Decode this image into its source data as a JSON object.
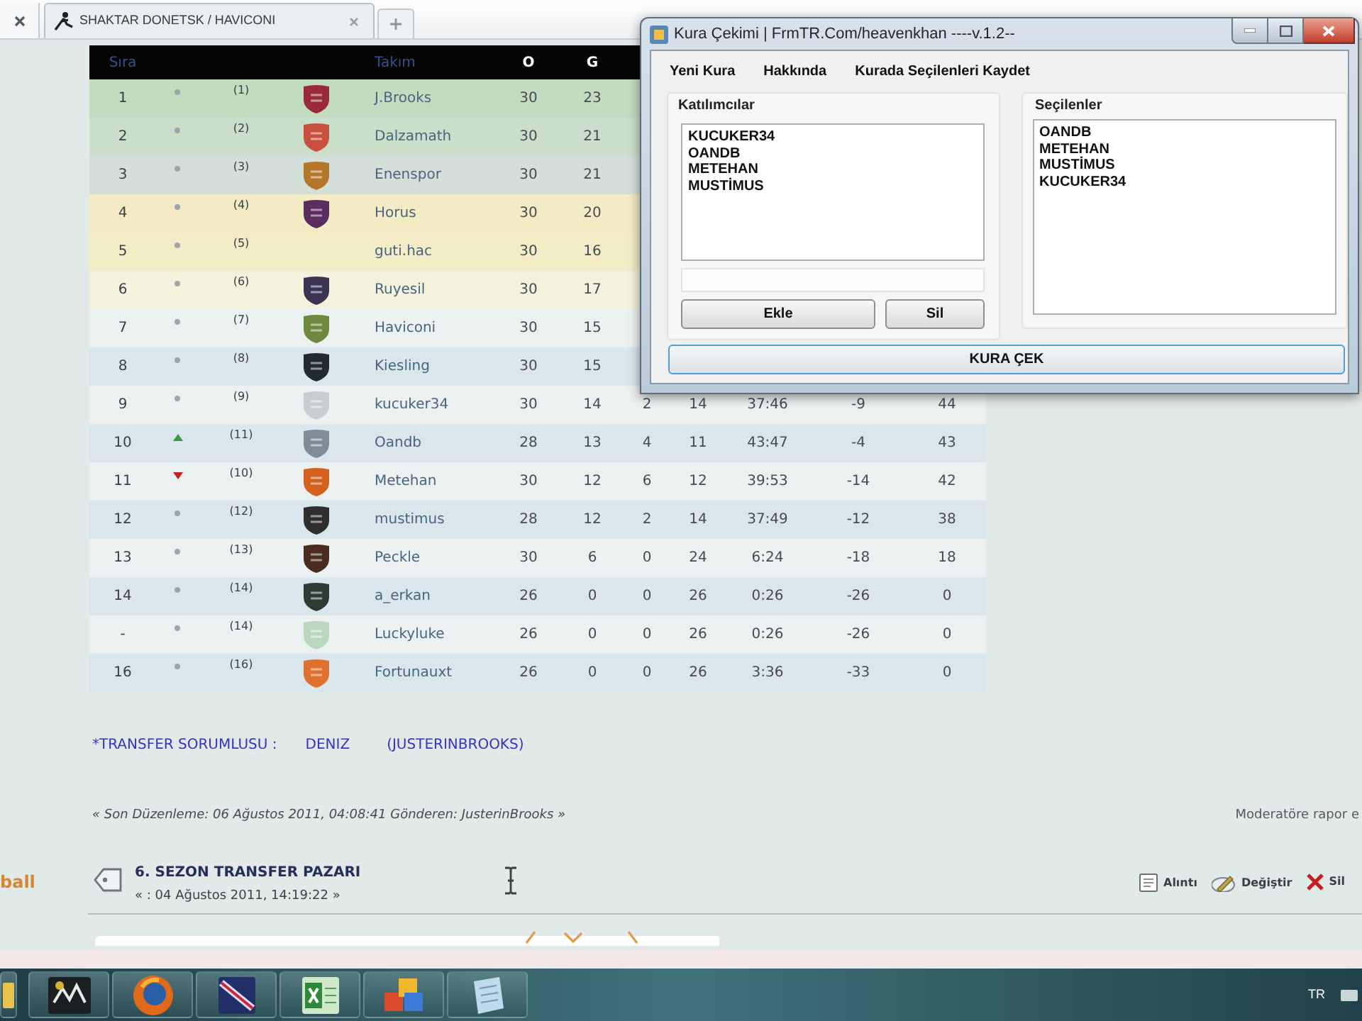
{
  "browser": {
    "tab_title": "SHAKTAR DONETSK / HAVICONI"
  },
  "standings": {
    "columns": [
      {
        "label": "Sıra",
        "kind": "link"
      },
      {
        "label": "Takım",
        "kind": "link"
      },
      {
        "label": "O",
        "kind": "plain"
      },
      {
        "label": "G",
        "kind": "plain"
      }
    ],
    "rows": [
      {
        "rank": "1",
        "kind": "dot",
        "column_3": "(1)",
        "crest": {
          "color": "#9a2a3a"
        },
        "team": "J.Brooks",
        "played": "30",
        "won": "23",
        "color": "#c3dcc0"
      },
      {
        "rank": "2",
        "kind": "dot",
        "column_3": "(2)",
        "crest": {
          "color": "#c8503c"
        },
        "team": "Dalzamath",
        "played": "30",
        "won": "21",
        "color": "#c9dfc9"
      },
      {
        "rank": "3",
        "kind": "dot",
        "column_3": "(3)",
        "crest": {
          "color": "#b5762a"
        },
        "team": "Enenspor",
        "played": "30",
        "won": "21",
        "color": "#d3e0da"
      },
      {
        "rank": "4",
        "kind": "dot",
        "column_3": "(4)",
        "crest": {
          "color": "#5a2d5e"
        },
        "team": "Horus",
        "played": "30",
        "won": "20",
        "color": "#f2ebc3"
      },
      {
        "rank": "5",
        "kind": "dot",
        "column_3": "(5)",
        "team": "guti.hac",
        "played": "30",
        "won": "16",
        "color": "#f2ecc7"
      },
      {
        "rank": "6",
        "kind": "dot",
        "column_3": "(6)",
        "crest": {
          "color": "#3b3452"
        },
        "team": "Ruyesil",
        "played": "30",
        "won": "17",
        "color": "#f4f2dc"
      },
      {
        "rank": "7",
        "kind": "dot",
        "column_3": "(7)",
        "crest": {
          "color": "#6c8a3e"
        },
        "team": "Haviconi",
        "played": "30",
        "won": "15",
        "color": "#ebf0f1"
      },
      {
        "rank": "8",
        "kind": "dot",
        "column_3": "(8)",
        "crest": {
          "color": "#1f2a33"
        },
        "team": "Kiesling",
        "played": "30",
        "won": "15",
        "color": "#d9e6ec"
      },
      {
        "rank": "9",
        "kind": "dot",
        "column_3": "(9)",
        "crest": {
          "color": "#c9cdd0"
        },
        "team": "kucuker34",
        "played": "30",
        "won": "14",
        "column_8": "2",
        "column_9": "14",
        "column_10": "37:46",
        "column_11": "-9",
        "column_12": "44",
        "color": "#ebf0f1"
      },
      {
        "rank": "10",
        "kind": "up",
        "column_3": "(11)",
        "crest": {
          "color": "#7d8c98"
        },
        "team": "Oandb",
        "played": "28",
        "won": "13",
        "column_8": "4",
        "column_9": "11",
        "column_10": "43:47",
        "column_11": "-4",
        "column_12": "43",
        "color": "#d9e6ec"
      },
      {
        "rank": "11",
        "kind": "down",
        "column_3": "(10)",
        "crest": {
          "color": "#d4601e"
        },
        "team": "Metehan",
        "played": "30",
        "won": "12",
        "column_8": "6",
        "column_9": "12",
        "column_10": "39:53",
        "column_11": "-14",
        "column_12": "42",
        "color": "#ebf0f1"
      },
      {
        "rank": "12",
        "kind": "dot",
        "column_3": "(12)",
        "crest": {
          "color": "#2e2e2e"
        },
        "team": "mustimus",
        "played": "28",
        "won": "12",
        "column_8": "2",
        "column_9": "14",
        "column_10": "37:49",
        "column_11": "-12",
        "column_12": "38",
        "color": "#d9e6ec"
      },
      {
        "rank": "13",
        "kind": "dot",
        "column_3": "(13)",
        "crest": {
          "color": "#4a2c22"
        },
        "team": "Peckle",
        "played": "30",
        "won": "6",
        "column_8": "0",
        "column_9": "24",
        "column_10": "6:24",
        "column_11": "-18",
        "column_12": "18",
        "color": "#ebf0f1"
      },
      {
        "rank": "14",
        "kind": "dot",
        "column_3": "(14)",
        "crest": {
          "color": "#2c3c34"
        },
        "team": "a_erkan",
        "played": "26",
        "won": "0",
        "column_8": "0",
        "column_9": "26",
        "column_10": "0:26",
        "column_11": "-26",
        "column_12": "0",
        "color": "#d9e6ec"
      },
      {
        "rank": "-",
        "kind": "dot",
        "column_3": "(14)",
        "crest": {
          "color": "#b9d8bb"
        },
        "team": "Luckyluke",
        "played": "26",
        "won": "0",
        "column_8": "0",
        "column_9": "26",
        "column_10": "0:26",
        "column_11": "-26",
        "column_12": "0",
        "color": "#ebf0f1"
      },
      {
        "rank": "16",
        "kind": "dot",
        "column_3": "(16)",
        "crest": {
          "color": "#e0702e"
        },
        "team": "Fortunauxt",
        "played": "26",
        "won": "0",
        "column_8": "0",
        "column_9": "26",
        "column_10": "3:36",
        "column_11": "-33",
        "column_12": "0",
        "color": "#d9e6ec"
      }
    ]
  },
  "post": {
    "transfer": {
      "label": "*TRANSFER SORUMLUSU :",
      "names": [
        "DENIZ",
        "(JUSTERINBROOKS)"
      ]
    },
    "edit_note": "« Son Düzenleme: 06 Ağustos 2011, 04:08:41 Gönderen: JusterinBrooks »",
    "report_link": "Moderatöre rapor e"
  },
  "next_post": {
    "poster": "ball",
    "title": "6. SEZON TRANSFER PAZARI",
    "date": "« : 04 Ağustos 2011, 14:19:22 »",
    "actions": [
      {
        "kind": "quote",
        "label": "Alıntı"
      },
      {
        "kind": "edit",
        "label": "Değiştir"
      },
      {
        "kind": "delete",
        "label": "Sil"
      }
    ]
  },
  "dialog": {
    "title": "Kura Çekimi | FrmTR.Com/heavenkhan ----v.1.2--",
    "menu": [
      "Yeni Kura",
      "Hakkında",
      "Kurada Seçilenleri Kaydet"
    ],
    "participants": {
      "label": "Katılımcılar",
      "items": [
        "KUCUKER34",
        "OANDB",
        "METEHAN",
        "MUSTİMUS"
      ]
    },
    "buttons": [
      "Ekle",
      "Sil"
    ],
    "chosen": {
      "label": "Seçilenler",
      "items": [
        "OANDB",
        "METEHAN",
        "MUSTİMUS",
        "KUCUKER34"
      ]
    },
    "draw_button": "KURA ÇEK"
  },
  "taskbar": {
    "language": "TR"
  }
}
